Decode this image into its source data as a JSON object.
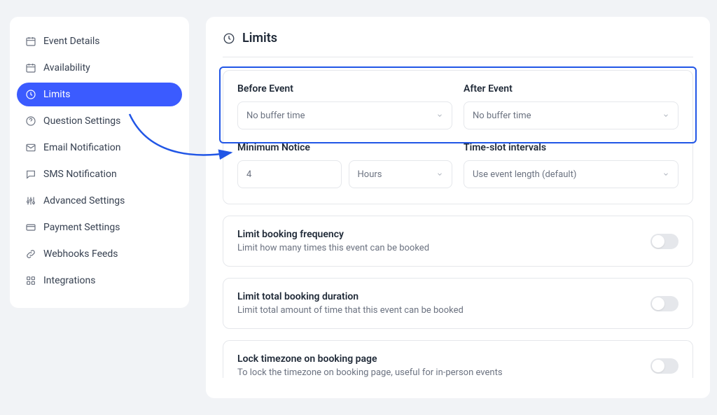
{
  "sidebar": {
    "items": [
      {
        "label": "Event Details"
      },
      {
        "label": "Availability"
      },
      {
        "label": "Limits"
      },
      {
        "label": "Question Settings"
      },
      {
        "label": "Email Notification"
      },
      {
        "label": "SMS Notification"
      },
      {
        "label": "Advanced Settings"
      },
      {
        "label": "Payment Settings"
      },
      {
        "label": "Webhooks Feeds"
      },
      {
        "label": "Integrations"
      }
    ],
    "activeIndex": 2
  },
  "page": {
    "title": "Limits"
  },
  "buffers": {
    "before": {
      "label": "Before Event",
      "value": "No buffer time"
    },
    "after": {
      "label": "After Event",
      "value": "No buffer time"
    },
    "minimumNotice": {
      "label": "Minimum Notice",
      "value": "4",
      "unit": "Hours"
    },
    "timeslot": {
      "label": "Time-slot intervals",
      "value": "Use event length (default)"
    }
  },
  "toggles": {
    "frequency": {
      "title": "Limit booking frequency",
      "desc": "Limit how many times this event can be booked",
      "on": false
    },
    "duration": {
      "title": "Limit total booking duration",
      "desc": "Limit total amount of time that this event can be booked",
      "on": false
    },
    "timezone": {
      "title": "Lock timezone on booking page",
      "desc": "To lock the timezone on booking page, useful for in-person events",
      "on": false
    }
  }
}
